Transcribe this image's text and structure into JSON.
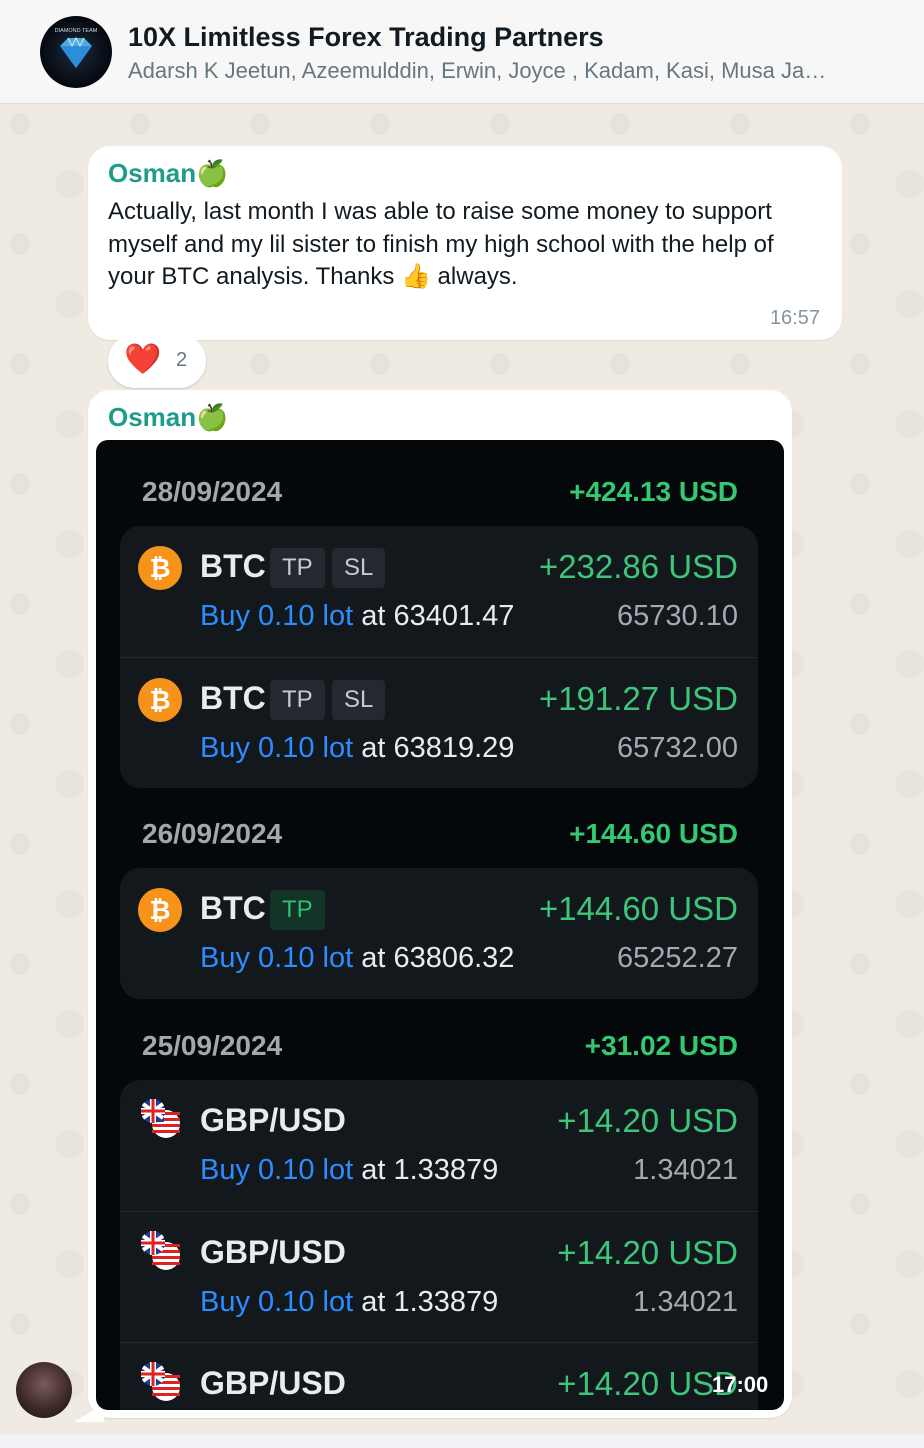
{
  "header": {
    "title": "10X Limitless Forex Trading Partners",
    "members": "Adarsh K Jeetun, Azeemulddin, Erwin, Joyce , Kadam, Kasi, Musa Ja…",
    "avatar_text": "DIAMOND TEAM"
  },
  "message1": {
    "sender": "Osman",
    "sender_emoji": "🍏",
    "text": "Actually, last month I was able to raise some money to support myself and my lil sister to finish my high school with the help of your BTC analysis.  Thanks 👍 always.",
    "time": "16:57",
    "reaction": {
      "emoji": "❤️",
      "count": "2"
    }
  },
  "message2": {
    "sender": "Osman",
    "sender_emoji": "🍏",
    "time": "17:00",
    "days": [
      {
        "date": "28/09/2024",
        "total": "+424.13 USD",
        "trades": [
          {
            "symbol": "BTC",
            "icon": "bitcoin-icon",
            "tags": [
              "TP",
              "SL"
            ],
            "pnl": "+232.86 USD",
            "side": "Buy 0.10 lot",
            "at": "at 63401.47",
            "price": "65730.10"
          },
          {
            "symbol": "BTC",
            "icon": "bitcoin-icon",
            "tags": [
              "TP",
              "SL"
            ],
            "pnl": "+191.27 USD",
            "side": "Buy 0.10 lot",
            "at": "at 63819.29",
            "price": "65732.00"
          }
        ]
      },
      {
        "date": "26/09/2024",
        "total": "+144.60 USD",
        "trades": [
          {
            "symbol": "BTC",
            "icon": "bitcoin-icon",
            "tags": [
              "TP"
            ],
            "pnl": "+144.60 USD",
            "side": "Buy 0.10 lot",
            "at": "at 63806.32",
            "price": "65252.27"
          }
        ]
      },
      {
        "date": "25/09/2024",
        "total": "+31.02 USD",
        "trades": [
          {
            "symbol": "GBP/USD",
            "icon": "uk-us-flag-icon",
            "tags": [],
            "pnl": "+14.20 USD",
            "side": "Buy 0.10 lot",
            "at": "at 1.33879",
            "price": "1.34021"
          },
          {
            "symbol": "GBP/USD",
            "icon": "uk-us-flag-icon",
            "tags": [],
            "pnl": "+14.20 USD",
            "side": "Buy 0.10 lot",
            "at": "at 1.33879",
            "price": "1.34021"
          },
          {
            "symbol": "GBP/USD",
            "icon": "uk-us-flag-icon",
            "tags": [],
            "pnl": "+14.20 USD",
            "side": "",
            "at": "",
            "price": ""
          }
        ]
      }
    ]
  },
  "colors": {
    "sender_name": "#1f9b8a",
    "profit_green": "#3ec57a",
    "buy_blue": "#2d8cff",
    "chat_bg": "#efeae2"
  }
}
